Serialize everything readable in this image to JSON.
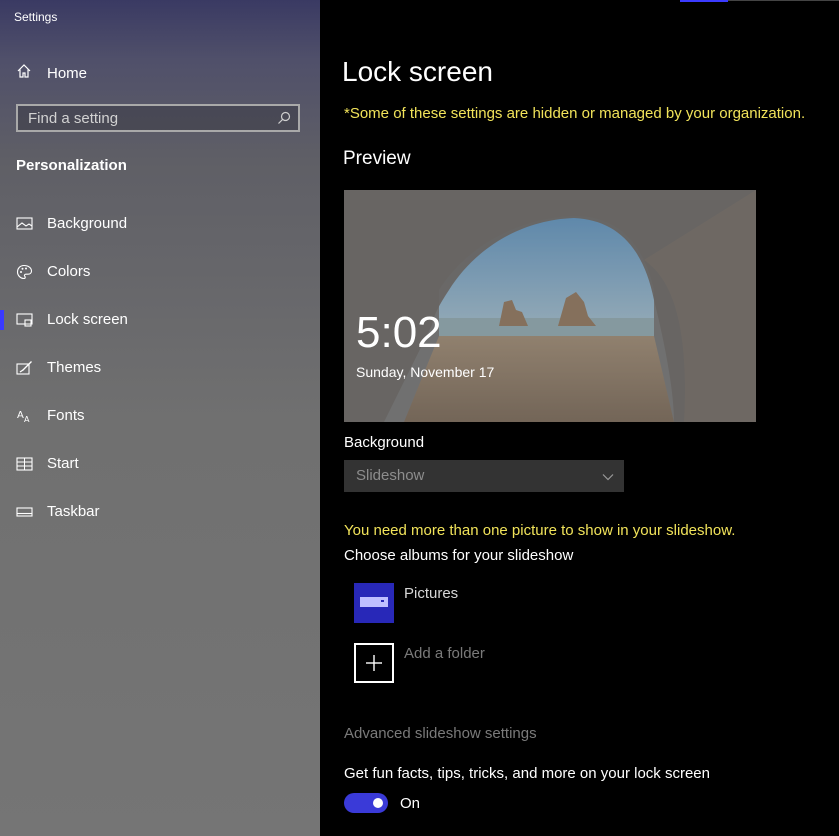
{
  "window": {
    "title": "Settings"
  },
  "sidebar": {
    "home_label": "Home",
    "search_placeholder": "Find a setting",
    "section": "Personalization",
    "items": [
      {
        "label": "Background",
        "icon": "picture-icon"
      },
      {
        "label": "Colors",
        "icon": "palette-icon"
      },
      {
        "label": "Lock screen",
        "icon": "lock-screen-icon",
        "active": true
      },
      {
        "label": "Themes",
        "icon": "brush-icon"
      },
      {
        "label": "Fonts",
        "icon": "font-icon"
      },
      {
        "label": "Start",
        "icon": "start-grid-icon"
      },
      {
        "label": "Taskbar",
        "icon": "taskbar-icon"
      }
    ]
  },
  "main": {
    "title": "Lock screen",
    "org_notice": "*Some of these settings are hidden or managed by your organization.",
    "preview_heading": "Preview",
    "preview": {
      "time": "5:02",
      "date": "Sunday, November 17"
    },
    "background_label": "Background",
    "background_value": "Slideshow",
    "slideshow_warning": "You need more than one picture to show in your slideshow.",
    "albums_label": "Choose albums for your slideshow",
    "album_item": "Pictures",
    "add_folder": "Add a folder",
    "advanced_link": "Advanced slideshow settings",
    "fun_facts_label": "Get fun facts, tips, tricks, and more on your lock screen",
    "toggle_state": "On"
  },
  "colors": {
    "accent": "#3a3ad8",
    "warning": "#f1e35a"
  }
}
